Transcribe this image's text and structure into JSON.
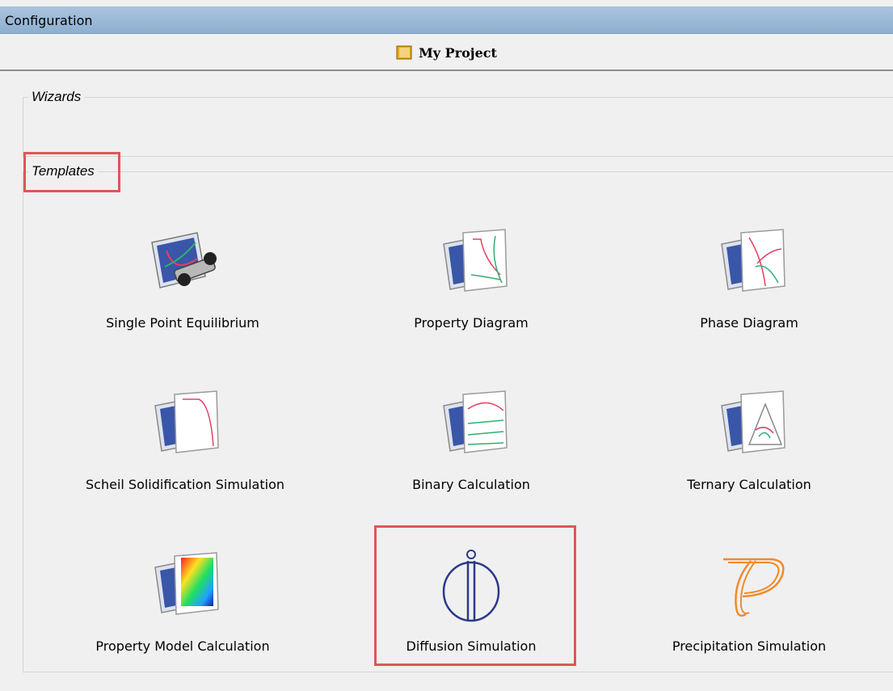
{
  "window": {
    "title": "Configuration"
  },
  "project": {
    "name": "My Project",
    "icon": "folder-icon"
  },
  "groups": {
    "wizards": {
      "label": "Wizards"
    },
    "templates": {
      "label": "Templates"
    }
  },
  "templates": [
    {
      "id": "single-point-equilibrium",
      "label": "Single Point Equilibrium",
      "icon": "single-point-equilibrium-icon"
    },
    {
      "id": "property-diagram",
      "label": "Property Diagram",
      "icon": "property-diagram-icon"
    },
    {
      "id": "phase-diagram",
      "label": "Phase Diagram",
      "icon": "phase-diagram-icon"
    },
    {
      "id": "scheil-solidification-simulation",
      "label": "Scheil Solidification Simulation",
      "icon": "scheil-icon"
    },
    {
      "id": "binary-calculation",
      "label": "Binary Calculation",
      "icon": "binary-calculation-icon"
    },
    {
      "id": "ternary-calculation",
      "label": "Ternary Calculation",
      "icon": "ternary-calculation-icon"
    },
    {
      "id": "property-model-calculation",
      "label": "Property Model Calculation",
      "icon": "property-model-icon"
    },
    {
      "id": "diffusion-simulation",
      "label": "Diffusion Simulation",
      "icon": "diffusion-icon"
    },
    {
      "id": "precipitation-simulation",
      "label": "Precipitation Simulation",
      "icon": "precipitation-icon"
    }
  ],
  "colors": {
    "highlight": "#e05656",
    "titlebar": "#9ab8d6",
    "diffusion_icon": "#2a3a8a",
    "precipitation_icon": "#f08a2a"
  }
}
